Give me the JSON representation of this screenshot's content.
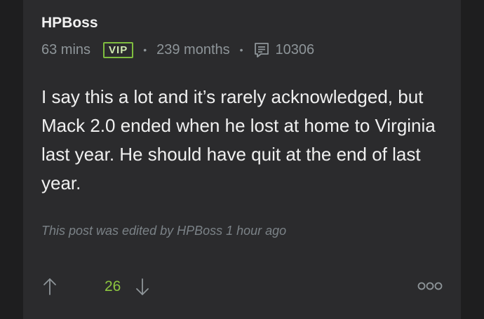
{
  "post": {
    "author": "HPBoss",
    "time_ago": "63 mins",
    "badge": "VIP",
    "separator": "•",
    "membership": "239 months",
    "post_count": "10306",
    "body": "I say this a lot and it’s rarely acknowledged, but Mack 2.0 ended when he lost at home to Virginia last year. He should have quit at the end of last year.",
    "edited_note": "This post was edited by HPBoss 1 hour ago",
    "score": "26"
  },
  "colors": {
    "background": "#1e1e1f",
    "card": "#2b2b2d",
    "accent_green": "#8cc63f",
    "muted_text": "#8e9599"
  },
  "icons": {
    "comment": "comment-icon",
    "upvote": "arrow-up-icon",
    "downvote": "arrow-down-icon",
    "more": "more-options-icon"
  }
}
